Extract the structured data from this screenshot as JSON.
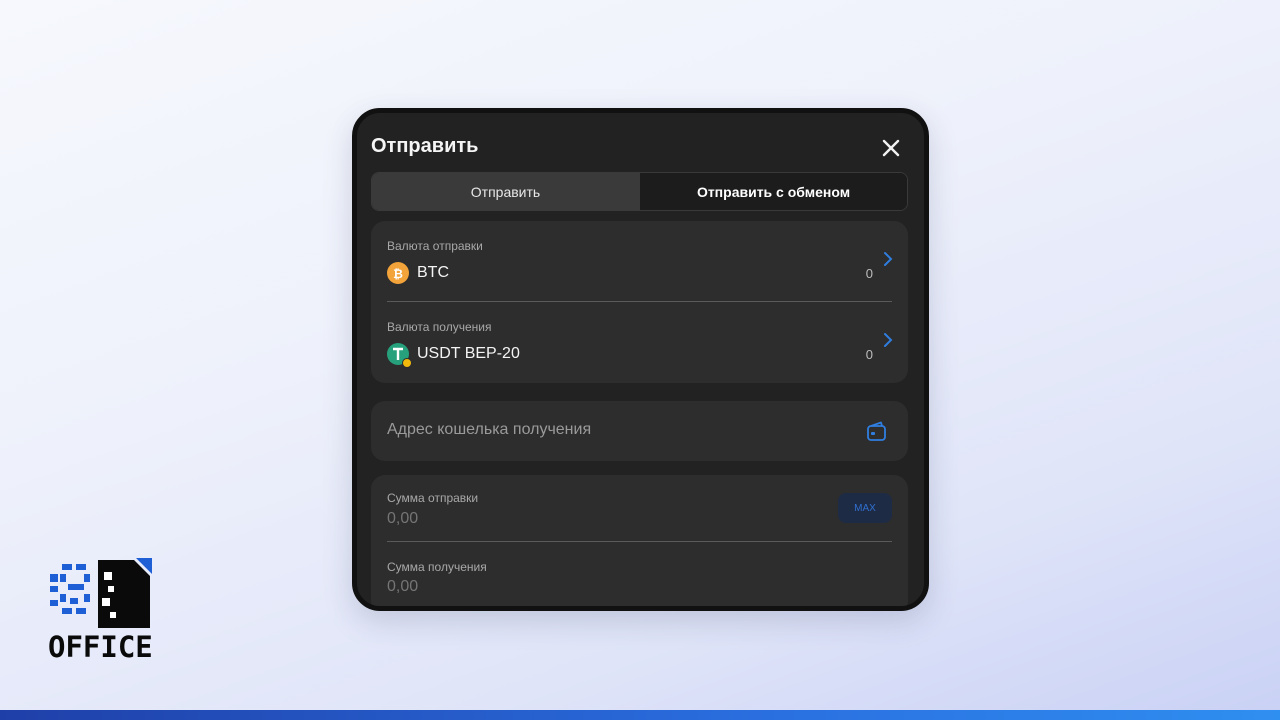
{
  "modal": {
    "title": "Отправить",
    "tabs": [
      {
        "label": "Отправить",
        "active": false
      },
      {
        "label": "Отправить с обменом",
        "active": true
      }
    ],
    "send_currency": {
      "label": "Валюта отправки",
      "name": "BTC",
      "balance": "0",
      "icon": "bitcoin-icon"
    },
    "receive_currency": {
      "label": "Валюта получения",
      "name": "USDT BEP-20",
      "balance": "0",
      "icon": "tether-icon"
    },
    "address": {
      "placeholder": "Адрес кошелька получения",
      "icon": "wallet-icon"
    },
    "send_amount": {
      "label": "Сумма отправки",
      "value": "0,00",
      "max_label": "MAX"
    },
    "receive_amount": {
      "label": "Сумма получения",
      "value": "0,00"
    }
  },
  "logo": {
    "text": "OFFICE"
  },
  "colors": {
    "accent": "#2f6fd0",
    "modal_bg": "#222222",
    "card_bg": "#2d2d2d",
    "btc": "#f2a33a",
    "usdt": "#26a17b"
  }
}
